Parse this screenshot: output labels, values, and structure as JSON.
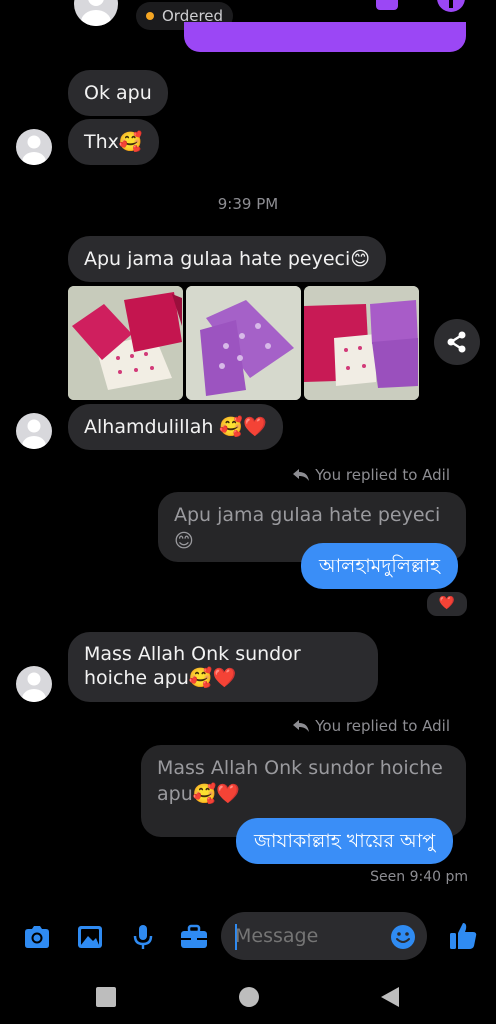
{
  "header": {
    "status": "Ordered",
    "status_color": "#f5a623",
    "accent": "#9b47f5"
  },
  "messages": {
    "m1": "Ok apu",
    "m2": "Thx🥰",
    "time1": "9:39 PM",
    "m3": "Apu jama gulaa hate peyeci😊",
    "m4": "Alhamdulillah 🥰❤️",
    "replied1": "You replied to Adil",
    "quote1": "Apu jama gulaa hate peyeci😊",
    "reply1": "আলহামদুলিল্লাহ",
    "reaction1": "❤️",
    "m5": "Mass Allah Onk sundor hoiche apu🥰❤️",
    "replied2": "You replied to Adil",
    "quote2": "Mass Allah Onk sundor hoiche apu🥰❤️",
    "reply2": "জাযাকাল্লাহ খায়ের আপু",
    "seen": "Seen 9:40 pm"
  },
  "composer": {
    "placeholder": "Message",
    "icons": [
      "camera-icon",
      "image-icon",
      "microphone-icon",
      "briefcase-icon",
      "emoji-icon",
      "thumbs-up-icon"
    ]
  },
  "navbar": {
    "icons": [
      "recents-icon",
      "home-icon",
      "back-icon"
    ]
  },
  "colors": {
    "incoming_bubble": "#2b2b2e",
    "outgoing_bubble": "#3a8ef7",
    "header_bubble": "#9b47f5"
  }
}
